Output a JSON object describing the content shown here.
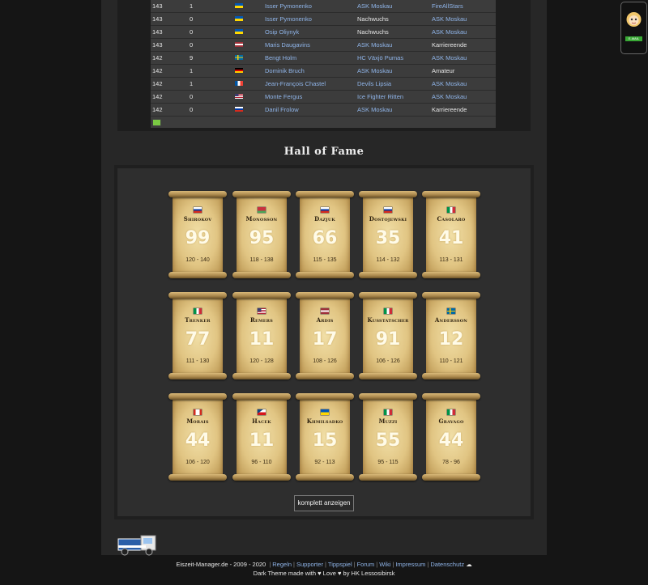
{
  "table": {
    "rows": [
      {
        "rating": "143",
        "goals": "1",
        "flag": "ua",
        "name": "Isser Pymonenko",
        "team": "ASK Moskau",
        "team_link": true,
        "club": "FireAllStars",
        "club_link": true
      },
      {
        "rating": "143",
        "goals": "0",
        "flag": "ua",
        "name": "Isser Pymonenko",
        "team": "Nachwuchs",
        "team_link": false,
        "club": "ASK Moskau",
        "club_link": true
      },
      {
        "rating": "143",
        "goals": "0",
        "flag": "ua",
        "name": "Osip Oliynyk",
        "team": "Nachwuchs",
        "team_link": false,
        "club": "ASK Moskau",
        "club_link": true
      },
      {
        "rating": "143",
        "goals": "0",
        "flag": "lv",
        "name": "Maris Daugavins",
        "team": "ASK Moskau",
        "team_link": true,
        "club": "Karriereende",
        "club_link": false
      },
      {
        "rating": "142",
        "goals": "9",
        "flag": "se",
        "name": "Bengt Holm",
        "team": "HC Växjö Pumas",
        "team_link": true,
        "club": "ASK Moskau",
        "club_link": true
      },
      {
        "rating": "142",
        "goals": "1",
        "flag": "de",
        "name": "Dominik Bruch",
        "team": "ASK Moskau",
        "team_link": true,
        "club": "Amateur",
        "club_link": false
      },
      {
        "rating": "142",
        "goals": "1",
        "flag": "fr",
        "name": "Jean-François Chastel",
        "team": "Devils Lipsia",
        "team_link": true,
        "club": "ASK Moskau",
        "club_link": true
      },
      {
        "rating": "142",
        "goals": "0",
        "flag": "us",
        "name": "Monte Fergus",
        "team": "Ice Fighter Ritten",
        "team_link": true,
        "club": "ASK Moskau",
        "club_link": true
      },
      {
        "rating": "142",
        "goals": "0",
        "flag": "ru",
        "name": "Danil Frolow",
        "team": "ASK Moskau",
        "team_link": true,
        "club": "Karriereende",
        "club_link": false
      }
    ]
  },
  "hall_of_fame": {
    "title": "Hall of Fame",
    "players": [
      {
        "name": "Shirokov",
        "flag": "ru",
        "number": "99",
        "range": "120 - 140"
      },
      {
        "name": "Monosson",
        "flag": "by",
        "number": "95",
        "range": "118 - 138"
      },
      {
        "name": "Dazjuk",
        "flag": "ru",
        "number": "66",
        "range": "115 - 135"
      },
      {
        "name": "Dostojewski",
        "flag": "ru",
        "number": "35",
        "range": "114 - 132"
      },
      {
        "name": "Casolaro",
        "flag": "it",
        "number": "41",
        "range": "113 - 131"
      },
      {
        "name": "Trenker",
        "flag": "it",
        "number": "77",
        "range": "111 - 130"
      },
      {
        "name": "Remers",
        "flag": "us",
        "number": "11",
        "range": "120 - 128"
      },
      {
        "name": "Ardis",
        "flag": "lv",
        "number": "17",
        "range": "108 - 126"
      },
      {
        "name": "Kusstatscher",
        "flag": "it",
        "number": "91",
        "range": "106 - 126"
      },
      {
        "name": "Andersson",
        "flag": "se",
        "number": "12",
        "range": "110 - 121"
      },
      {
        "name": "Morais",
        "flag": "ca",
        "number": "44",
        "range": "106 - 120"
      },
      {
        "name": "Hacek",
        "flag": "cz",
        "number": "11",
        "range": "96 - 110"
      },
      {
        "name": "Khmilsadko",
        "flag": "ua",
        "number": "15",
        "range": "92 - 113"
      },
      {
        "name": "Muzzi",
        "flag": "it",
        "number": "55",
        "range": "95 - 115"
      },
      {
        "name": "Gravago",
        "flag": "it",
        "number": "44",
        "range": "78 - 96"
      }
    ],
    "show_all_label": "komplett anzeigen"
  },
  "footer": {
    "copyright": "Eiszeit-Manager.de - 2009 - 2020",
    "links": [
      "Regeln",
      "Supporter",
      "Tippspiel",
      "Forum",
      "Wiki",
      "Impressum",
      "Datenschutz"
    ],
    "theme_credit": "Dark Theme made with ♥ Love ♥ by HK Lessosibirsk"
  },
  "phone_badge": "E-MAIL",
  "colors": {
    "link": "#8fb4e8",
    "background": "#151515",
    "panel": "#272727"
  }
}
